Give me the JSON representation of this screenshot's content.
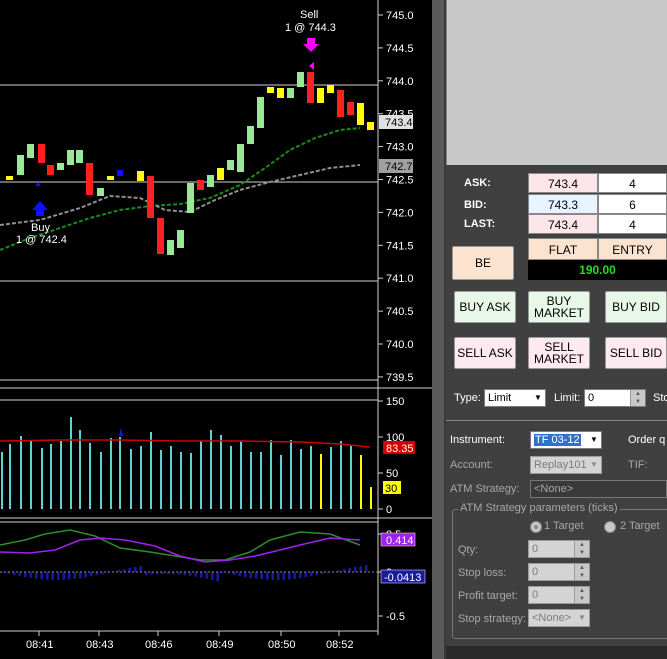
{
  "chart": {
    "price_axis": [
      "745.0",
      "744.5",
      "744.0",
      "743.5",
      "743.0",
      "742.5",
      "742.0",
      "741.5",
      "741.0",
      "740.5",
      "740.0",
      "739.5"
    ],
    "last_price_tag": "743.4",
    "ma_tag": "742.7",
    "volume_axis": [
      "150",
      "100",
      "50",
      "0"
    ],
    "volume_avg_tag": "83.35",
    "volume_last_tag": "30",
    "osc_axis": [
      "0.5",
      "0",
      "-0.5"
    ],
    "osc_tag_1": "0.414",
    "osc_tag_2": "-0.0413",
    "time_axis": [
      "08:41",
      "08:43",
      "08:46",
      "08:49",
      "08:50",
      "08:52"
    ],
    "sell_label": "Sell",
    "sell_detail": "1 @ 744.3",
    "buy_label": "Buy",
    "buy_detail": "1 @ 742.4",
    "colors": {
      "up": "#98e898",
      "down": "#ff2020",
      "neutral": "#ffff00",
      "volume": "#5fd3d3",
      "volume_avg": "#d00000",
      "osc_fast": "#a020f0",
      "osc_slow": "#2e8b2e",
      "osc_hist": "#1a1aa0",
      "ma_fast": "#1a8a1a",
      "ma_slow": "#909090"
    }
  },
  "quotes": {
    "ask_label": "ASK:",
    "ask_price": "743.4",
    "ask_size": "4",
    "bid_label": "BID:",
    "bid_price": "743.3",
    "bid_size": "6",
    "last_label": "LAST:",
    "last_price": "743.4",
    "last_size": "4"
  },
  "position": {
    "be_label": "BE",
    "flat_label": "FLAT",
    "entry_label": "ENTRY",
    "pnl": "190.00"
  },
  "buttons": {
    "buy_ask": "BUY ASK",
    "buy_market": "BUY MARKET",
    "buy_bid": "BUY BID",
    "sell_ask": "SELL ASK",
    "sell_market": "SELL MARKET",
    "sell_bid": "SELL BID"
  },
  "order": {
    "type_label": "Type:",
    "type_value": "Limit",
    "limit_label": "Limit:",
    "limit_value": "0",
    "stop_label_partial": "Sto",
    "instrument_label": "Instrument:",
    "instrument_value": "TF 03-12",
    "order_qty_partial": "Order q",
    "account_label": "Account:",
    "account_value": "Replay101",
    "tif_label": "TIF:",
    "atm_label": "ATM Strategy:",
    "atm_value": "<None>"
  },
  "atm_params": {
    "group_title": "ATM Strategy parameters (ticks)",
    "target1": "1 Target",
    "target2": "2 Target",
    "qty_label": "Qty:",
    "qty_value": "0",
    "stop_loss_label": "Stop loss:",
    "stop_loss_value": "0",
    "profit_target_label": "Profit target:",
    "profit_target_value": "0",
    "stop_strategy_label": "Stop strategy:",
    "stop_strategy_value": "<None>"
  }
}
